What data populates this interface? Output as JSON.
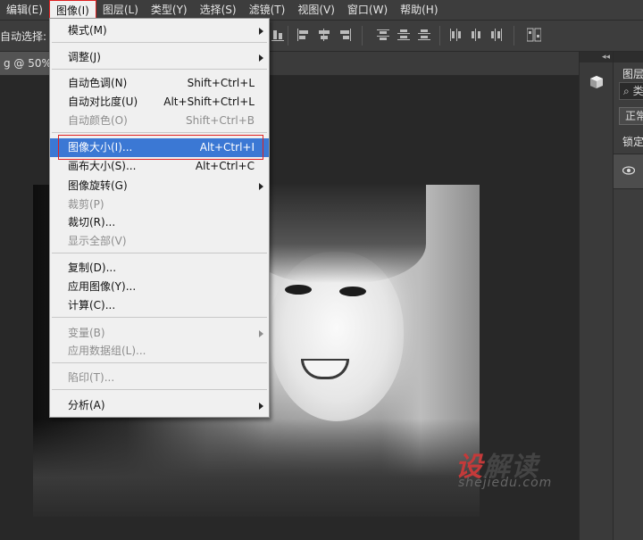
{
  "menubar": {
    "items": [
      "编辑(E)",
      "图像(I)",
      "图层(L)",
      "类型(Y)",
      "选择(S)",
      "滤镜(T)",
      "视图(V)",
      "窗口(W)",
      "帮助(H)"
    ]
  },
  "optionsbar": {
    "auto_select_label": "自动选择:"
  },
  "document": {
    "tab_title": "g @ 50%("
  },
  "image_menu": [
    {
      "label": "模式(M)",
      "shortcut": "",
      "submenu": true,
      "disabled": false
    },
    {
      "label": "调整(J)",
      "shortcut": "",
      "submenu": true,
      "disabled": false
    },
    {
      "label": "自动色调(N)",
      "shortcut": "Shift+Ctrl+L",
      "disabled": false
    },
    {
      "label": "自动对比度(U)",
      "shortcut": "Alt+Shift+Ctrl+L",
      "disabled": false
    },
    {
      "label": "自动颜色(O)",
      "shortcut": "Shift+Ctrl+B",
      "disabled": true
    },
    {
      "label": "图像大小(I)...",
      "shortcut": "Alt+Ctrl+I",
      "disabled": false,
      "highlighted": true
    },
    {
      "label": "画布大小(S)...",
      "shortcut": "Alt+Ctrl+C",
      "disabled": false
    },
    {
      "label": "图像旋转(G)",
      "shortcut": "",
      "submenu": true,
      "disabled": false
    },
    {
      "label": "裁剪(P)",
      "shortcut": "",
      "disabled": true
    },
    {
      "label": "裁切(R)...",
      "shortcut": "",
      "disabled": false
    },
    {
      "label": "显示全部(V)",
      "shortcut": "",
      "disabled": true
    },
    {
      "label": "复制(D)...",
      "shortcut": "",
      "disabled": false
    },
    {
      "label": "应用图像(Y)...",
      "shortcut": "",
      "disabled": false
    },
    {
      "label": "计算(C)...",
      "shortcut": "",
      "disabled": false
    },
    {
      "label": "变量(B)",
      "shortcut": "",
      "submenu": true,
      "disabled": true
    },
    {
      "label": "应用数据组(L)...",
      "shortcut": "",
      "disabled": true
    },
    {
      "label": "陷印(T)...",
      "shortcut": "",
      "disabled": true
    },
    {
      "label": "分析(A)",
      "shortcut": "",
      "submenu": true,
      "disabled": false
    }
  ],
  "layers_panel": {
    "tab_label": "图层",
    "search_text": "类",
    "blend_mode": "正常",
    "lock_label": "锁定"
  },
  "watermark": {
    "cn_part1": "设",
    "cn_part2": "解读",
    "en": "shejiedu.com"
  },
  "colors": {
    "highlight": "#3b78d4",
    "callout": "#e02020",
    "menu_bg": "#f0f0f0"
  }
}
